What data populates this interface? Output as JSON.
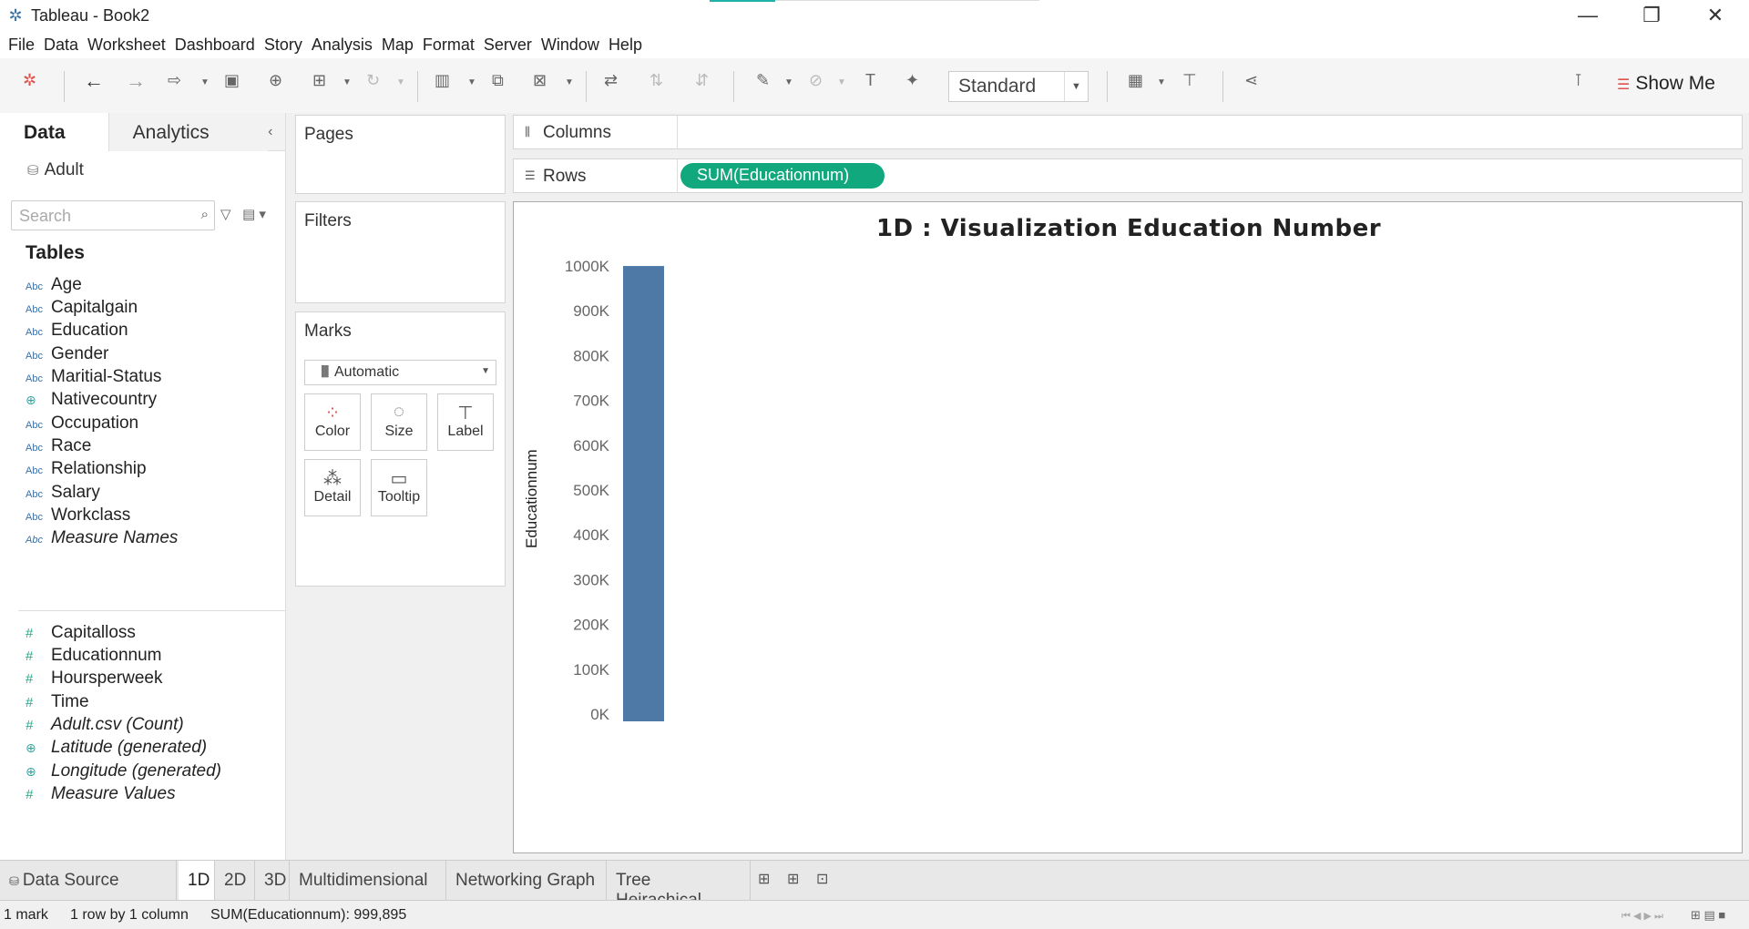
{
  "window": {
    "title": "Tableau - Book2"
  },
  "menu": [
    "File",
    "Data",
    "Worksheet",
    "Dashboard",
    "Story",
    "Analysis",
    "Map",
    "Format",
    "Server",
    "Window",
    "Help"
  ],
  "toolbar": {
    "fit_select": "Standard",
    "show_me": "Show Me"
  },
  "data_pane": {
    "tabs": [
      "Data",
      "Analytics"
    ],
    "datasource": "Adult",
    "search_placeholder": "Search",
    "tables_header": "Tables",
    "dimensions": [
      {
        "name": "Age",
        "type": "Abc"
      },
      {
        "name": "Capitalgain",
        "type": "Abc"
      },
      {
        "name": "Education",
        "type": "Abc"
      },
      {
        "name": "Gender",
        "type": "Abc"
      },
      {
        "name": "Maritial-Status",
        "type": "Abc"
      },
      {
        "name": "Nativecountry",
        "type": "geo"
      },
      {
        "name": "Occupation",
        "type": "Abc"
      },
      {
        "name": "Race",
        "type": "Abc"
      },
      {
        "name": "Relationship",
        "type": "Abc"
      },
      {
        "name": "Salary",
        "type": "Abc"
      },
      {
        "name": "Workclass",
        "type": "Abc"
      },
      {
        "name": "Measure Names",
        "type": "Abc"
      }
    ],
    "measures": [
      {
        "name": "Capitalloss",
        "type": "#"
      },
      {
        "name": "Educationnum",
        "type": "#"
      },
      {
        "name": "Hoursperweek",
        "type": "#"
      },
      {
        "name": "Time",
        "type": "#"
      },
      {
        "name": "Adult.csv (Count)",
        "type": "#"
      },
      {
        "name": "Latitude (generated)",
        "type": "geo"
      },
      {
        "name": "Longitude (generated)",
        "type": "geo"
      },
      {
        "name": "Measure Values",
        "type": "#"
      }
    ]
  },
  "cards": {
    "pages": "Pages",
    "filters": "Filters",
    "marks": "Marks",
    "marks_type": "Automatic",
    "mark_buttons": [
      "Color",
      "Size",
      "Label",
      "Detail",
      "Tooltip"
    ]
  },
  "shelves": {
    "columns": "Columns",
    "rows": "Rows",
    "rows_pill": "SUM(Educationnum)"
  },
  "chart_data": {
    "type": "bar",
    "title": "1D : Visualization Education Number",
    "xlabel": "",
    "ylabel": "Educationnum",
    "categories": [
      ""
    ],
    "values": [
      999895
    ],
    "ylim": [
      0,
      1000000
    ],
    "yticks": [
      "0K",
      "100K",
      "200K",
      "300K",
      "400K",
      "500K",
      "600K",
      "700K",
      "800K",
      "900K",
      "1000K"
    ],
    "bar_color": "#4e79a7",
    "grid": false
  },
  "sheets": {
    "data_source": "Data Source",
    "tabs": [
      "1D",
      "2D",
      "3D",
      "Multidimensional",
      "Networking Graph",
      "Tree Heirachical"
    ],
    "active": "1D"
  },
  "status": {
    "marks": "1 mark",
    "dims": "1 row by 1 column",
    "sum": "SUM(Educationnum): 999,895"
  }
}
